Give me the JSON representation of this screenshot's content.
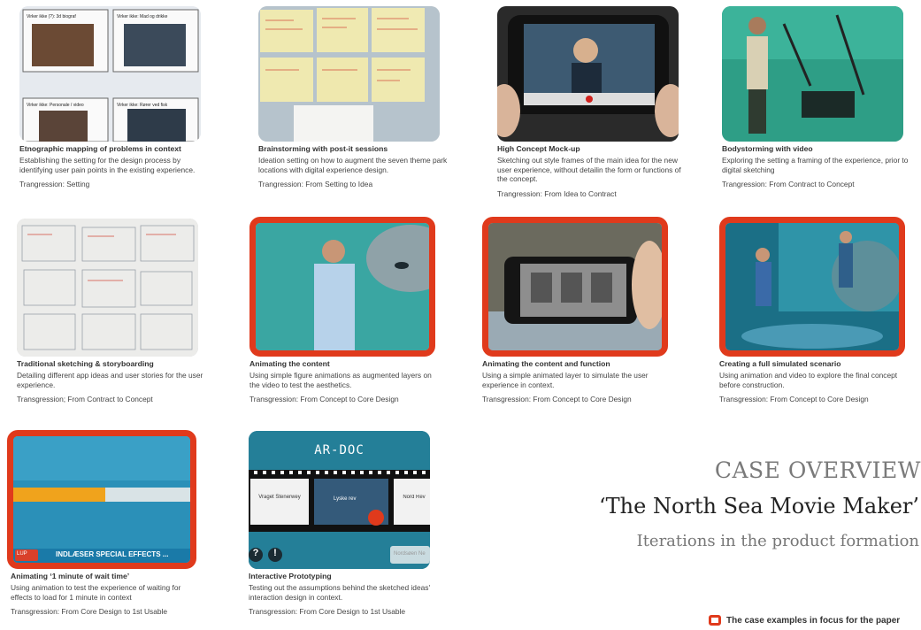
{
  "cards": [
    {
      "title": "Etnographic mapping of problems in context",
      "desc": "Establishing the setting for the design process by identifying user pain points in the existing experience.",
      "trans": "Trangression: Setting",
      "labels": [
        "Virker ikke (?): 3d biograf",
        "Virker ikke: Mad og drikke",
        "Virker ikke: Personale / video",
        "Virker ikke: Rører ved fisk"
      ]
    },
    {
      "title": "Brainstorming with post-it sessions",
      "desc": "Ideation setting on how to augment the seven theme park locations with digital experience design.",
      "trans": "Trangression: From Setting to Idea"
    },
    {
      "title": "High Concept Mock-up",
      "desc": "Sketching out style frames of the main idea for the new user experience, without detailin the form or functions of the concept.",
      "trans": "Trangression: From Idea to Contract"
    },
    {
      "title": "Bodystorming with video",
      "desc": "Exploring the setting a framing of the experience, prior to digital sketching",
      "trans": "Trangression: From Contract to Concept"
    },
    {
      "title": "Traditional sketching & storyboarding",
      "desc": "Detailing different app ideas and user stories for the user experience.",
      "trans": "Transgression; From Contract to Concept"
    },
    {
      "title": "Animating the content",
      "desc": "Using simple figure animations as augmented layers on the video to test the aesthetics.",
      "trans": "Transgression: From Concept to Core Design"
    },
    {
      "title": "Animating the content and function",
      "desc": "Using a simple animated layer to simulate the user experience in context.",
      "trans": "Transgression: From Concept to Core Design"
    },
    {
      "title": "Creating a full simulated scenario",
      "desc": "Using animation and video to explore the final concept before construction.",
      "trans": "Transgression: From Concept to Core Design"
    },
    {
      "title": "Animating ‘1 minute of wait time’",
      "desc": "Using animation to test the experience of waiting for effects to load for 1 minute in context",
      "trans": "Transgression: From Core Design to 1st Usable",
      "loading": "INDLÆSER SPECIAL EFFECTS ...",
      "btn": "LUP"
    },
    {
      "title": "Interactive Prototyping",
      "desc": "Testing out the assumptions behind the sketched ideas' interaction design in context.",
      "trans": "Transgression: From Core Design to 1st Usable",
      "app_title": "AR-DOC",
      "frames": [
        "Vraget Stenerwey",
        "Lyske rev",
        "Nord Rev"
      ],
      "btn": "Nordsøen Ne"
    }
  ],
  "overview": {
    "heading": "CASE OVERVIEW",
    "name": "‘The North Sea Movie Maker’",
    "subtitle": "Iterations in the product  formation"
  },
  "legend": "The case examples in focus for the paper",
  "colors": {
    "highlight": "#e03a1c",
    "heading": "#7a7a7a"
  }
}
